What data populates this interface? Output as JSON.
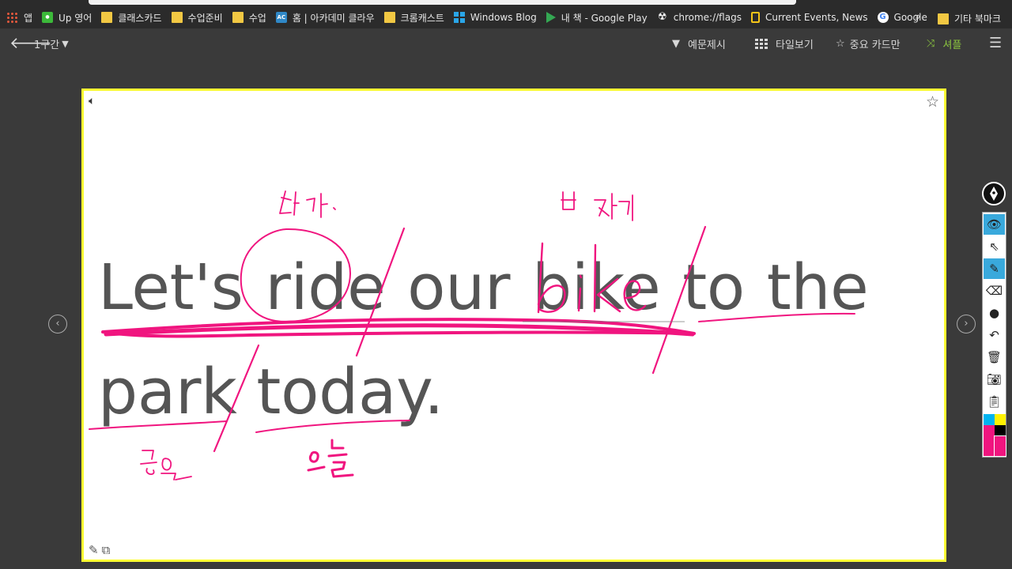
{
  "bookmarks": [
    {
      "icon": "apps-icon",
      "label": "앱"
    },
    {
      "icon": "line-icon",
      "label": "Up 영어"
    },
    {
      "icon": "folder-icon",
      "label": "클래스카드"
    },
    {
      "icon": "folder-icon",
      "label": "수업준비"
    },
    {
      "icon": "folder-icon",
      "label": "수업"
    },
    {
      "icon": "ac-icon",
      "label": "홈 | 아카데미 클라우"
    },
    {
      "icon": "folder-icon",
      "label": "크롬캐스트"
    },
    {
      "icon": "windows-icon",
      "label": "Windows Blog"
    },
    {
      "icon": "play-icon",
      "label": "내 책 - Google Play"
    },
    {
      "icon": "flags-icon",
      "label": "chrome://flags"
    },
    {
      "icon": "natgeo-icon",
      "label": "Current Events, News"
    },
    {
      "icon": "google-icon",
      "label": "Google"
    }
  ],
  "bookmarks_more": "»",
  "bookmarks_other": "기타 북마크",
  "toolbar": {
    "section": "1구간",
    "hint": "예문제시",
    "tile": "타일보기",
    "important": "중요 카드만",
    "shuffle": "셔플"
  },
  "card": {
    "sentence_line1": "Let's ride our bike to the",
    "sentence_line2": "park today.",
    "annotations": {
      "ride": "타다",
      "bike": "자전거",
      "park": "공원",
      "today": "오늘"
    }
  },
  "colors": {
    "ink": "#f0157f",
    "card_border": "#ffff33",
    "palette_active": "#39a9dc",
    "swatch_cyan": "#00b4f0",
    "swatch_yellow": "#fff200",
    "swatch_magenta": "#f0157f",
    "swatch_black": "#000000"
  },
  "palette_tools": [
    "eye-icon",
    "pointer-icon",
    "pen-icon",
    "eraser-icon",
    "dot-icon",
    "undo-icon",
    "trash-icon",
    "camera-icon",
    "clipboard-icon"
  ]
}
